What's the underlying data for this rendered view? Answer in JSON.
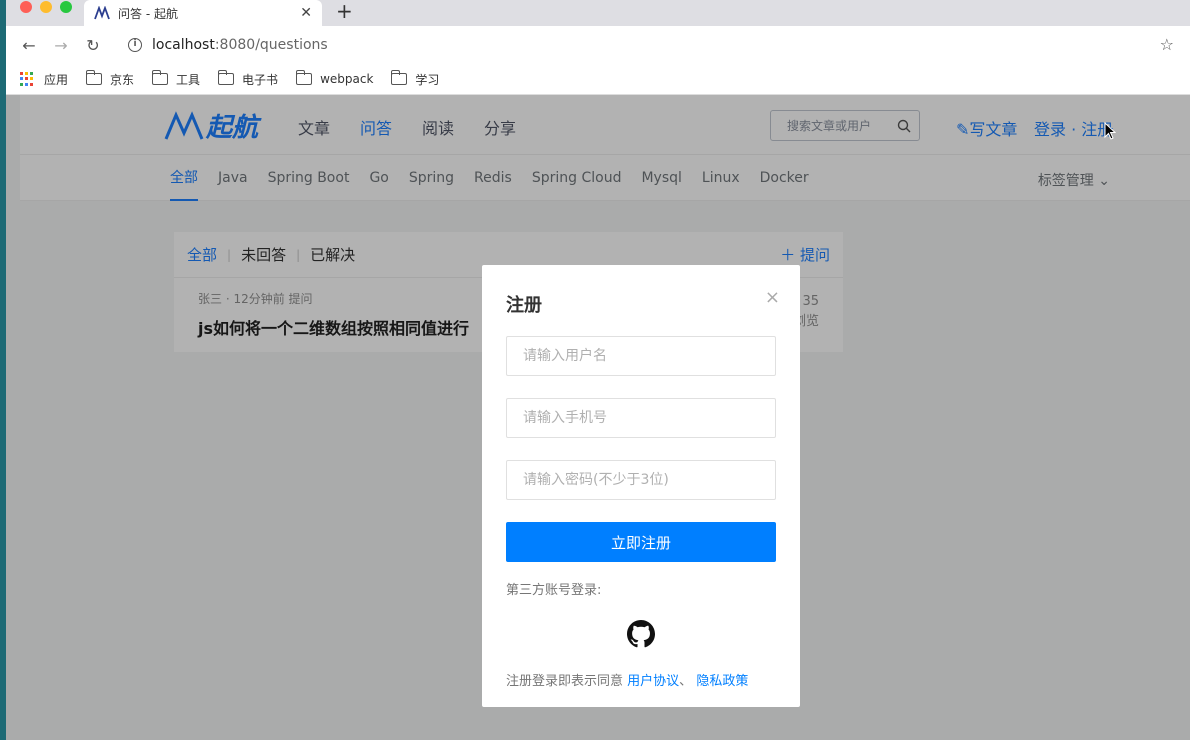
{
  "browser": {
    "tab_title": "问答 - 起航",
    "tab_close": "✕",
    "new_tab": "+",
    "url_host": "localhost",
    "url_rest": ":8080/questions",
    "bookmarks": [
      {
        "label": "应用",
        "icon": "apps-grid-icon"
      },
      {
        "label": "京东",
        "icon": "folder-icon"
      },
      {
        "label": "工具",
        "icon": "folder-icon"
      },
      {
        "label": "电子书",
        "icon": "folder-icon"
      },
      {
        "label": "webpack",
        "icon": "folder-icon"
      },
      {
        "label": "学习",
        "icon": "folder-icon"
      }
    ]
  },
  "site": {
    "logo_text": "起航",
    "nav": [
      "文章",
      "问答",
      "阅读",
      "分享"
    ],
    "search_placeholder": "搜索文章或用户",
    "write_label": "写文章",
    "login_label": "登录 · 注册",
    "subnav": [
      "全部",
      "Java",
      "Spring Boot",
      "Go",
      "Spring",
      "Redis",
      "Spring Cloud",
      "Mysql",
      "Linux",
      "Docker"
    ],
    "tag_manage": "标签管理",
    "accent": "#1e80ff"
  },
  "questions": {
    "filters": [
      "全部",
      "未回答",
      "已解决"
    ],
    "ask_label": "提问",
    "items": [
      {
        "meta": "张三 · 12分钟前 提问",
        "title": "js如何将一个二维数组按照相同值进行",
        "count": "35",
        "count_label": "浏览"
      }
    ]
  },
  "modal": {
    "title": "注册",
    "username_placeholder": "请输入用户名",
    "phone_placeholder": "请输入手机号",
    "password_placeholder": "请输入密码(不少于3位)",
    "submit_label": "立即注册",
    "oauth_label": "第三方账号登录:",
    "agreement_prefix": "注册登录即表示同意",
    "agreement_link1": "用户协议",
    "agreement_sep": "、",
    "agreement_link2": "隐私政策"
  }
}
